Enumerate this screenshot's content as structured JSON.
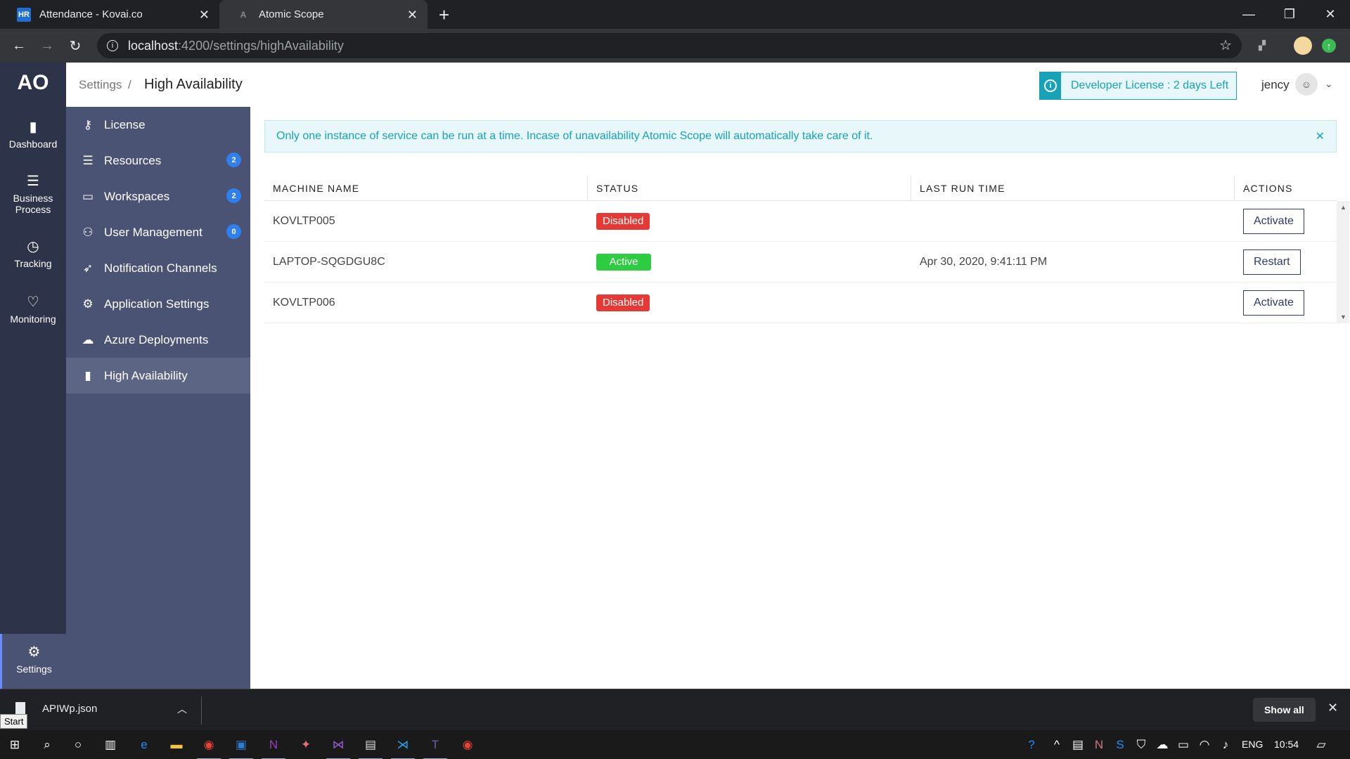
{
  "browser": {
    "tabs": [
      {
        "favicon": "HR",
        "title": "Attendance - Kovai.co",
        "close": "✕"
      },
      {
        "favicon": "A",
        "title": "Atomic Scope",
        "close": "✕"
      }
    ],
    "new_tab": "+",
    "window_controls": [
      "—",
      "❐",
      "✕"
    ],
    "url_host": "localhost",
    "url_path": ":4200/settings/highAvailability",
    "nav": {
      "back": "←",
      "forward": "→",
      "reload": "↻"
    },
    "info_icon": "i",
    "star": "☆"
  },
  "app": {
    "logo": "AO",
    "left_nav": [
      {
        "icon": "bar-chart-icon",
        "glyph": "▮",
        "label": "Dashboard"
      },
      {
        "icon": "list-icon",
        "glyph": "☰",
        "label": "Business Process"
      },
      {
        "icon": "clock-icon",
        "glyph": "◷",
        "label": "Tracking"
      },
      {
        "icon": "heart-icon",
        "glyph": "♡",
        "label": "Monitoring"
      },
      {
        "icon": "gear-icon",
        "glyph": "⚙",
        "label": "Settings",
        "active": true
      }
    ],
    "sub_nav": [
      {
        "icon": "key-icon",
        "glyph": "⚷",
        "label": "License",
        "badge": ""
      },
      {
        "icon": "list-icon",
        "glyph": "☰",
        "label": "Resources",
        "badge": "2"
      },
      {
        "icon": "briefcase-icon",
        "glyph": "▭",
        "label": "Workspaces",
        "badge": "2"
      },
      {
        "icon": "users-icon",
        "glyph": "⚇",
        "label": "User Management",
        "badge": "0"
      },
      {
        "icon": "rocket-icon",
        "glyph": "➶",
        "label": "Notification Channels",
        "badge": ""
      },
      {
        "icon": "cogs-icon",
        "glyph": "⚙",
        "label": "Application Settings",
        "badge": ""
      },
      {
        "icon": "cloud-upload-icon",
        "glyph": "☁",
        "label": "Azure Deployments",
        "badge": ""
      },
      {
        "icon": "bar-chart-icon",
        "glyph": "▮",
        "label": "High Availability",
        "badge": "",
        "active": true
      }
    ],
    "header": {
      "breadcrumb_parent": "Settings",
      "breadcrumb_separator": "/",
      "breadcrumb_current": "High Availability",
      "license_icon": "i",
      "license_text": "Developer License : 2 days Left",
      "user_name": "jency",
      "avatar_glyph": "☺",
      "chevron": "⌄"
    },
    "alert": {
      "text": "Only one instance of service can be run at a time. Incase of unavailability Atomic Scope will automatically take care of it.",
      "close": "✕"
    },
    "table": {
      "columns": [
        "MACHINE NAME",
        "STATUS",
        "LAST RUN TIME",
        "ACTIONS"
      ],
      "rows": [
        {
          "machine": "KOVLTP005",
          "status": "Disabled",
          "status_kind": "disabled",
          "last_run": "",
          "action": "Activate"
        },
        {
          "machine": "LAPTOP-SQGDGU8C",
          "status": "Active",
          "status_kind": "active",
          "last_run": "Apr 30, 2020, 9:41:11 PM",
          "action": "Restart"
        },
        {
          "machine": "KOVLTP006",
          "status": "Disabled",
          "status_kind": "disabled",
          "last_run": "",
          "action": "Activate"
        }
      ]
    }
  },
  "download_bar": {
    "file_name": "APIWp.json",
    "chevron": "︿",
    "show_all": "Show all",
    "close": "✕",
    "start_tooltip": "Start"
  },
  "taskbar": {
    "tray": {
      "language": "ENG",
      "time": "10:54"
    }
  },
  "colors": {
    "nav_bg": "#2d3348",
    "subnav_bg": "#4b5374",
    "info": "#17a2b8",
    "disabled": "#e53935",
    "active": "#2ecc40",
    "badge": "#2f80ed"
  }
}
